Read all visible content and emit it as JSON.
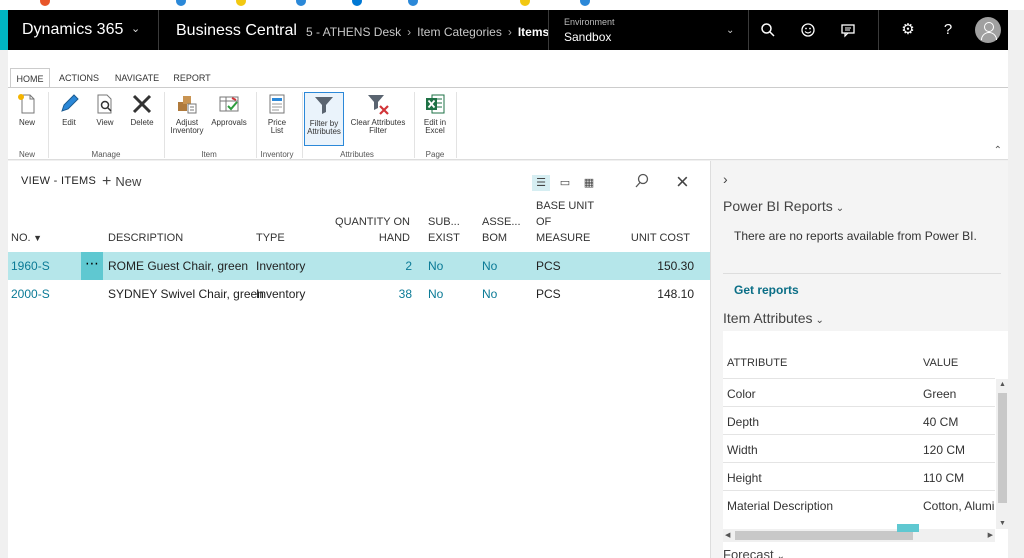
{
  "navbar": {
    "product": "Dynamics 365",
    "app": "Business Central",
    "breadcrumbs": [
      "5 - ATHENS Desk",
      "Item Categories"
    ],
    "current_page": "Items",
    "environment_label": "Environment",
    "environment_value": "Sandbox",
    "icons": [
      "search-icon",
      "smiley-icon",
      "chat-icon",
      "gear-icon",
      "help-icon",
      "user-avatar-icon"
    ],
    "help_glyph": "?"
  },
  "ribbon": {
    "tabs": [
      "HOME",
      "ACTIONS",
      "NAVIGATE",
      "REPORT"
    ],
    "active_tab": "HOME",
    "buttons": {
      "new": "New",
      "edit": "Edit",
      "view": "View",
      "delete": "Delete",
      "adjust_l1": "Adjust",
      "adjust_l2": "Inventory",
      "approvals": "Approvals",
      "price_l1": "Price",
      "price_l2": "List",
      "filter_l1": "Filter by",
      "filter_l2": "Attributes",
      "clear_l1": "Clear Attributes",
      "clear_l2": "Filter",
      "excel_l1": "Edit in",
      "excel_l2": "Excel"
    },
    "groups": {
      "new": "New",
      "manage": "Manage",
      "item": "Item",
      "inventory": "Inventory",
      "attributes": "Attributes",
      "page": "Page"
    },
    "accent_color": "#2b88d8"
  },
  "list": {
    "title": "VIEW - ITEMS",
    "new_label": "New",
    "columns": {
      "no": "NO.",
      "description": "DESCRIPTION",
      "type": "TYPE",
      "qty_l1": "QUANTITY ON",
      "qty_l2": "HAND",
      "sub_l1": "SUB...",
      "sub_l2": "EXIST",
      "asse_l1": "ASSE...",
      "asse_l2": "BOM",
      "buom_l1": "BASE UNIT",
      "buom_l2": "OF",
      "buom_l3": "MEASURE",
      "cost": "UNIT COST"
    },
    "rows": [
      {
        "no": "1960-S",
        "description": "ROME Guest Chair, green",
        "type": "Inventory",
        "qty": "2",
        "sub": "No",
        "asse": "No",
        "buom": "PCS",
        "cost": "150.30"
      },
      {
        "no": "2000-S",
        "description": "SYDNEY Swivel Chair, green",
        "type": "Inventory",
        "qty": "38",
        "sub": "No",
        "asse": "No",
        "buom": "PCS",
        "cost": "148.10"
      }
    ],
    "selected_row_color": "#b5e6ea",
    "link_color": "#0a7a96"
  },
  "factbox": {
    "powerbi_title": "Power BI Reports",
    "powerbi_message": "There are no reports available from Power BI.",
    "get_reports": "Get reports",
    "attributes_title": "Item Attributes",
    "attr_col": "ATTRIBUTE",
    "value_col": "VALUE",
    "attributes": [
      {
        "name": "Color",
        "value": "Green"
      },
      {
        "name": "Depth",
        "value": "40 CM"
      },
      {
        "name": "Width",
        "value": "120 CM"
      },
      {
        "name": "Height",
        "value": "110 CM"
      },
      {
        "name": "Material Description",
        "value": "Cotton, Alumi"
      }
    ],
    "forecast_title": "Forecast"
  }
}
